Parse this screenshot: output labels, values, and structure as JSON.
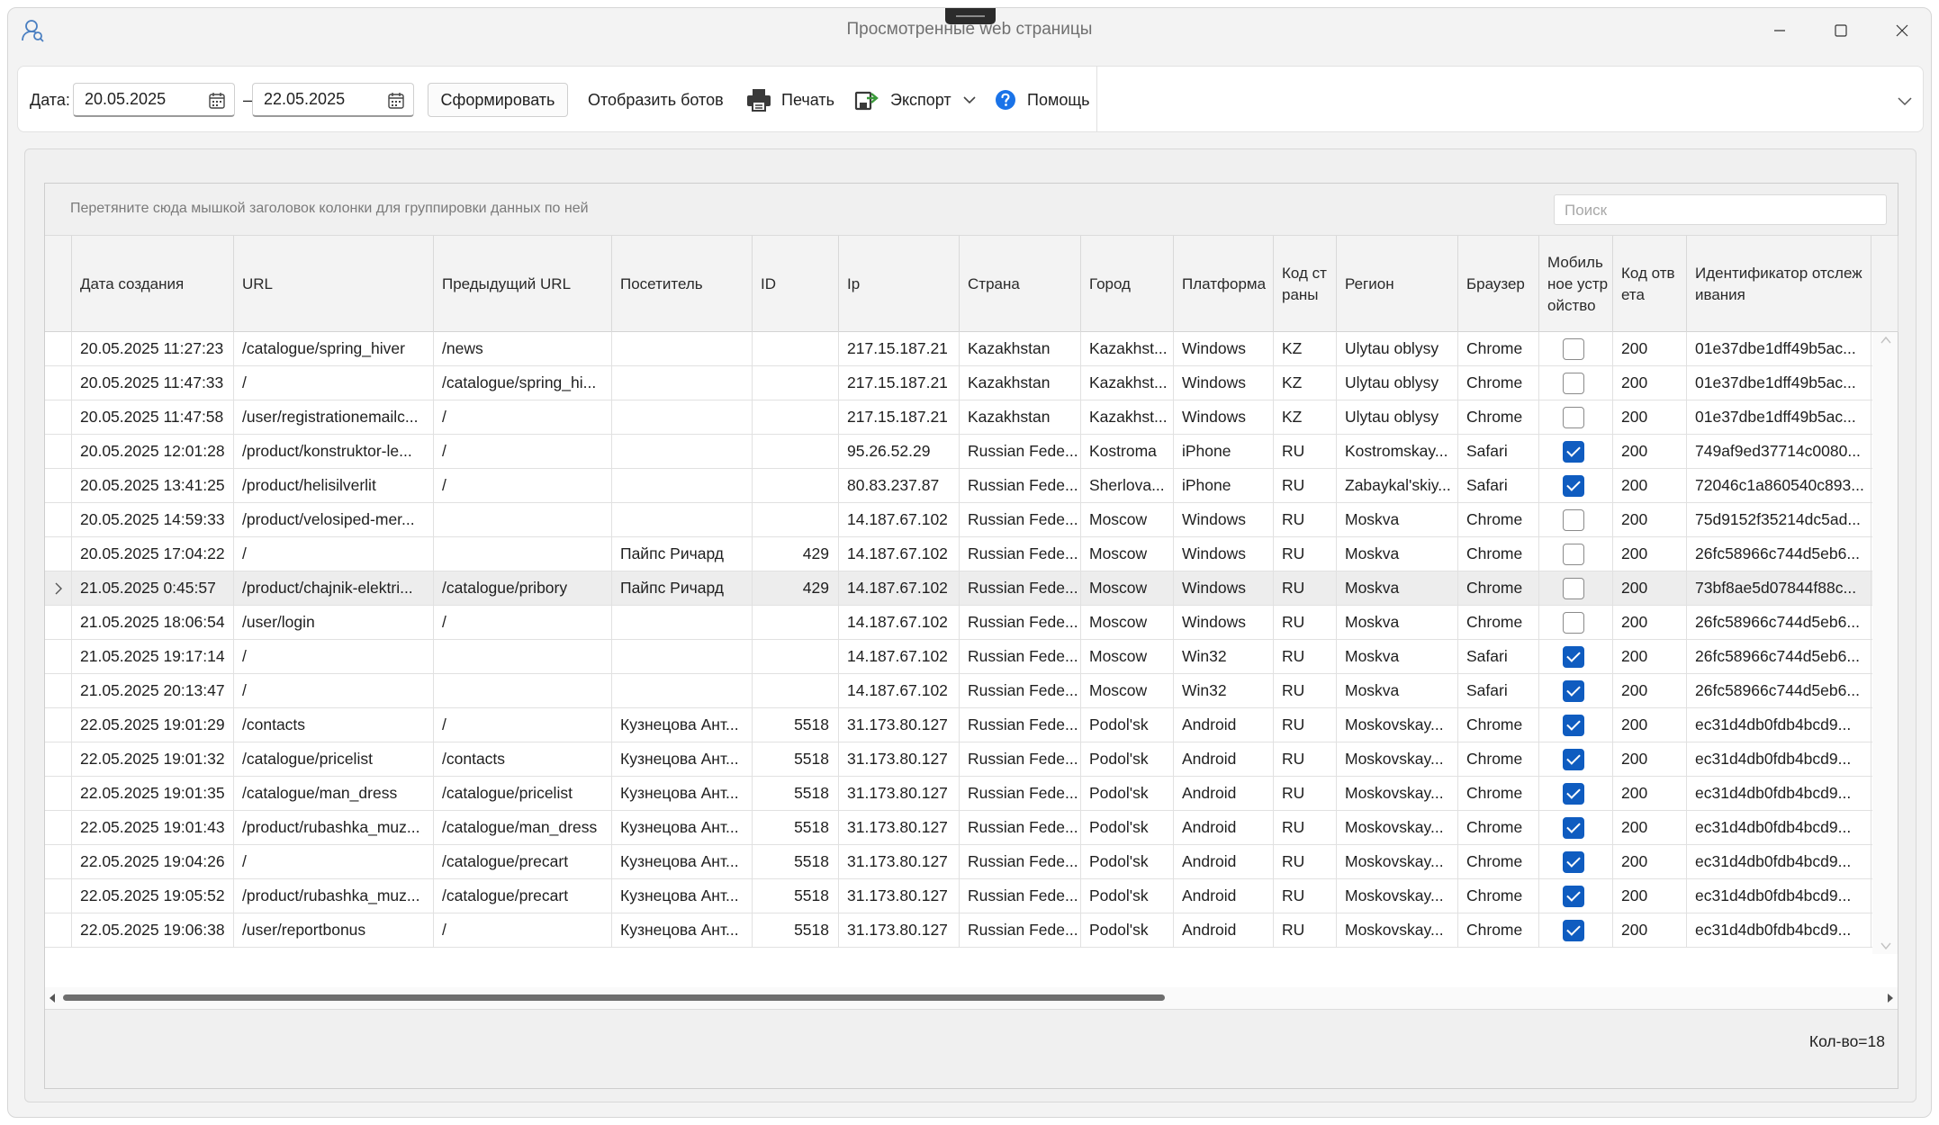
{
  "window": {
    "title": "Просмотренные web страницы",
    "controls": [
      "minimize-icon",
      "maximize-icon",
      "close-icon"
    ]
  },
  "toolbar": {
    "date_label": "Дата:",
    "date_from": "20.05.2025",
    "dash": "–",
    "date_to": "22.05.2025",
    "generate": "Сформировать",
    "show_bots": "Отобразить ботов",
    "print": "Печать",
    "export": "Экспорт",
    "help": "Помощь"
  },
  "grid": {
    "group_hint": "Перетяните сюда мышкой заголовок колонки для группировки данных по ней",
    "search_placeholder": "Поиск",
    "columns": [
      "Дата создания",
      "URL",
      "Предыдущий URL",
      "Посетитель",
      "ID",
      "Ip",
      "Страна",
      "Город",
      "Платформа",
      "Код страны",
      "Регион",
      "Браузер",
      "Мобильное устройство",
      "Код ответа",
      "Идентификатор отслеживания"
    ],
    "rows": [
      {
        "date": "20.05.2025 11:27:23",
        "url": "/catalogue/spring_hiver",
        "prev": "/news",
        "visitor": "",
        "id": "",
        "ip": "217.15.187.21",
        "country": "Kazakhstan",
        "city": "Kazakhst...",
        "platform": "Windows",
        "cc": "KZ",
        "region": "Ulytau oblysy",
        "browser": "Chrome",
        "mobile": false,
        "code": "200",
        "track": "01e37dbe1dff49b5ac..."
      },
      {
        "date": "20.05.2025 11:47:33",
        "url": "/",
        "prev": "/catalogue/spring_hi...",
        "visitor": "",
        "id": "",
        "ip": "217.15.187.21",
        "country": "Kazakhstan",
        "city": "Kazakhst...",
        "platform": "Windows",
        "cc": "KZ",
        "region": "Ulytau oblysy",
        "browser": "Chrome",
        "mobile": false,
        "code": "200",
        "track": "01e37dbe1dff49b5ac..."
      },
      {
        "date": "20.05.2025 11:47:58",
        "url": "/user/registrationemailc...",
        "prev": "/",
        "visitor": "",
        "id": "",
        "ip": "217.15.187.21",
        "country": "Kazakhstan",
        "city": "Kazakhst...",
        "platform": "Windows",
        "cc": "KZ",
        "region": "Ulytau oblysy",
        "browser": "Chrome",
        "mobile": false,
        "code": "200",
        "track": "01e37dbe1dff49b5ac..."
      },
      {
        "date": "20.05.2025 12:01:28",
        "url": "/product/konstruktor-le...",
        "prev": "/",
        "visitor": "",
        "id": "",
        "ip": "95.26.52.29",
        "country": "Russian Fede...",
        "city": "Kostroma",
        "platform": "iPhone",
        "cc": "RU",
        "region": "Kostromskay...",
        "browser": "Safari",
        "mobile": true,
        "code": "200",
        "track": "749af9ed37714c0080..."
      },
      {
        "date": "20.05.2025 13:41:25",
        "url": "/product/helisilverlit",
        "prev": "/",
        "visitor": "",
        "id": "",
        "ip": "80.83.237.87",
        "country": "Russian Fede...",
        "city": "Sherlova...",
        "platform": "iPhone",
        "cc": "RU",
        "region": "Zabaykal'skiy...",
        "browser": "Safari",
        "mobile": true,
        "code": "200",
        "track": "72046c1a860540c893..."
      },
      {
        "date": "20.05.2025 14:59:33",
        "url": "/product/velosiped-mer...",
        "prev": "",
        "visitor": "",
        "id": "",
        "ip": "14.187.67.102",
        "country": "Russian Fede...",
        "city": "Moscow",
        "platform": "Windows",
        "cc": "RU",
        "region": "Moskva",
        "browser": "Chrome",
        "mobile": false,
        "code": "200",
        "track": "75d9152f35214dc5ad..."
      },
      {
        "date": "20.05.2025 17:04:22",
        "url": "/",
        "prev": "",
        "visitor": "Пайпс Ричард",
        "id": "429",
        "ip": "14.187.67.102",
        "country": "Russian Fede...",
        "city": "Moscow",
        "platform": "Windows",
        "cc": "RU",
        "region": "Moskva",
        "browser": "Chrome",
        "mobile": false,
        "code": "200",
        "track": "26fc58966c744d5eb6..."
      },
      {
        "date": "21.05.2025 0:45:57",
        "url": "/product/chajnik-elektri...",
        "prev": "/catalogue/pribory",
        "visitor": "Пайпс Ричард",
        "id": "429",
        "ip": "14.187.67.102",
        "country": "Russian Fede...",
        "city": "Moscow",
        "platform": "Windows",
        "cc": "RU",
        "region": "Moskva",
        "browser": "Chrome",
        "mobile": false,
        "code": "200",
        "track": "73bf8ae5d07844f88c...",
        "selected": true
      },
      {
        "date": "21.05.2025 18:06:54",
        "url": "/user/login",
        "prev": "/",
        "visitor": "",
        "id": "",
        "ip": "14.187.67.102",
        "country": "Russian Fede...",
        "city": "Moscow",
        "platform": "Windows",
        "cc": "RU",
        "region": "Moskva",
        "browser": "Chrome",
        "mobile": false,
        "code": "200",
        "track": "26fc58966c744d5eb6..."
      },
      {
        "date": "21.05.2025 19:17:14",
        "url": "/",
        "prev": "",
        "visitor": "",
        "id": "",
        "ip": "14.187.67.102",
        "country": "Russian Fede...",
        "city": "Moscow",
        "platform": "Win32",
        "cc": "RU",
        "region": "Moskva",
        "browser": "Safari",
        "mobile": true,
        "code": "200",
        "track": "26fc58966c744d5eb6..."
      },
      {
        "date": "21.05.2025 20:13:47",
        "url": "/",
        "prev": "",
        "visitor": "",
        "id": "",
        "ip": "14.187.67.102",
        "country": "Russian Fede...",
        "city": "Moscow",
        "platform": "Win32",
        "cc": "RU",
        "region": "Moskva",
        "browser": "Safari",
        "mobile": true,
        "code": "200",
        "track": "26fc58966c744d5eb6..."
      },
      {
        "date": "22.05.2025 19:01:29",
        "url": "/contacts",
        "prev": "/",
        "visitor": "Кузнецова Ант...",
        "id": "5518",
        "ip": "31.173.80.127",
        "country": "Russian Fede...",
        "city": "Podol'sk",
        "platform": "Android",
        "cc": "RU",
        "region": "Moskovskay...",
        "browser": "Chrome",
        "mobile": true,
        "code": "200",
        "track": "ec31d4db0fdb4bcd9..."
      },
      {
        "date": "22.05.2025 19:01:32",
        "url": "/catalogue/pricelist",
        "prev": "/contacts",
        "visitor": "Кузнецова Ант...",
        "id": "5518",
        "ip": "31.173.80.127",
        "country": "Russian Fede...",
        "city": "Podol'sk",
        "platform": "Android",
        "cc": "RU",
        "region": "Moskovskay...",
        "browser": "Chrome",
        "mobile": true,
        "code": "200",
        "track": "ec31d4db0fdb4bcd9..."
      },
      {
        "date": "22.05.2025 19:01:35",
        "url": "/catalogue/man_dress",
        "prev": "/catalogue/pricelist",
        "visitor": "Кузнецова Ант...",
        "id": "5518",
        "ip": "31.173.80.127",
        "country": "Russian Fede...",
        "city": "Podol'sk",
        "platform": "Android",
        "cc": "RU",
        "region": "Moskovskay...",
        "browser": "Chrome",
        "mobile": true,
        "code": "200",
        "track": "ec31d4db0fdb4bcd9..."
      },
      {
        "date": "22.05.2025 19:01:43",
        "url": "/product/rubashka_muz...",
        "prev": "/catalogue/man_dress",
        "visitor": "Кузнецова Ант...",
        "id": "5518",
        "ip": "31.173.80.127",
        "country": "Russian Fede...",
        "city": "Podol'sk",
        "platform": "Android",
        "cc": "RU",
        "region": "Moskovskay...",
        "browser": "Chrome",
        "mobile": true,
        "code": "200",
        "track": "ec31d4db0fdb4bcd9..."
      },
      {
        "date": "22.05.2025 19:04:26",
        "url": "/",
        "prev": "/catalogue/precart",
        "visitor": "Кузнецова Ант...",
        "id": "5518",
        "ip": "31.173.80.127",
        "country": "Russian Fede...",
        "city": "Podol'sk",
        "platform": "Android",
        "cc": "RU",
        "region": "Moskovskay...",
        "browser": "Chrome",
        "mobile": true,
        "code": "200",
        "track": "ec31d4db0fdb4bcd9..."
      },
      {
        "date": "22.05.2025 19:05:52",
        "url": "/product/rubashka_muz...",
        "prev": "/catalogue/precart",
        "visitor": "Кузнецова Ант...",
        "id": "5518",
        "ip": "31.173.80.127",
        "country": "Russian Fede...",
        "city": "Podol'sk",
        "platform": "Android",
        "cc": "RU",
        "region": "Moskovskay...",
        "browser": "Chrome",
        "mobile": true,
        "code": "200",
        "track": "ec31d4db0fdb4bcd9..."
      },
      {
        "date": "22.05.2025 19:06:38",
        "url": "/user/reportbonus",
        "prev": "/",
        "visitor": "Кузнецова Ант...",
        "id": "5518",
        "ip": "31.173.80.127",
        "country": "Russian Fede...",
        "city": "Podol'sk",
        "platform": "Android",
        "cc": "RU",
        "region": "Moskovskay...",
        "browser": "Chrome",
        "mobile": true,
        "code": "200",
        "track": "ec31d4db0fdb4bcd9..."
      }
    ],
    "count_label": "Кол-во=18"
  },
  "colors": {
    "accent": "#0f5cc0",
    "help_icon": "#1a73e8",
    "export_icon": "#3a9a3a"
  }
}
